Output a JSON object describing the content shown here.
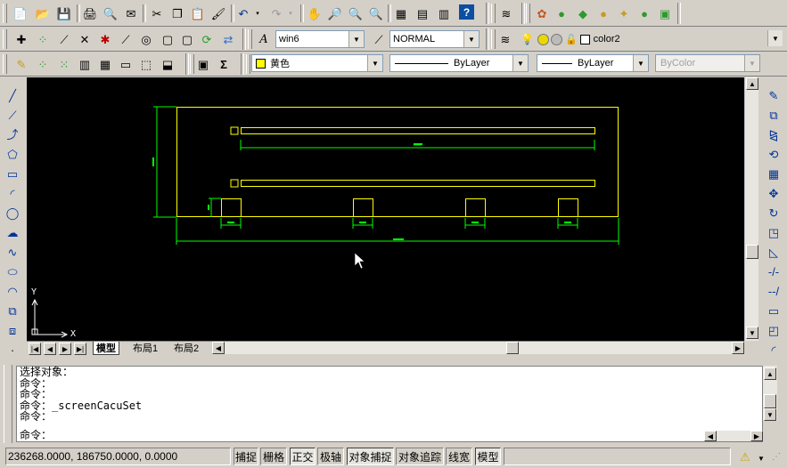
{
  "toolbars": {
    "text_style": "win6",
    "dim_style": "NORMAL",
    "layer": "color2",
    "color": "黄色",
    "linetype": "ByLayer",
    "lineweight": "ByLayer",
    "plot_style": "ByColor"
  },
  "drawing": {
    "ucs_y": "Y",
    "ucs_x": "X",
    "dim_top_bar": "12000",
    "dim_overall": "12000",
    "dim_left": "2500",
    "dim_small_left": "500",
    "dim_small": "500"
  },
  "tabs": {
    "model": "模型",
    "layout1": "布局1",
    "layout2": "布局2"
  },
  "command": {
    "lines": [
      "选择对象：",
      "命令：",
      "命令：",
      "命令：_screenCacuSet",
      "命令："
    ],
    "prompt": "命令："
  },
  "status": {
    "coords": "236268.0000,  186750.0000,  0.0000",
    "snap": "捕捉",
    "grid": "栅格",
    "ortho": "正交",
    "polar": "极轴",
    "osnap": "对象捕捉",
    "otrack": "对象追踪",
    "lwt": "线宽",
    "model": "模型"
  },
  "colors": {
    "canvas": "#000000",
    "geometry": "#ffff00",
    "dimension": "#00ff00"
  }
}
